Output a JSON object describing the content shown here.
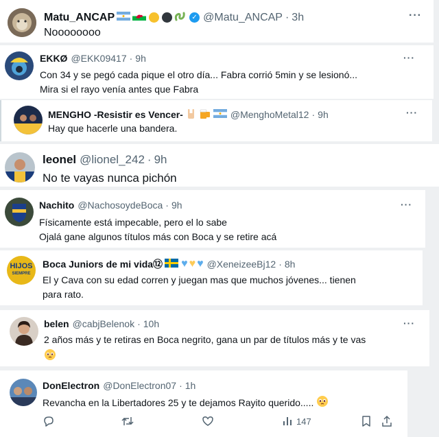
{
  "tweets": [
    {
      "name": "Matu_ANCAP",
      "handle": "@Matu_ANCAP",
      "time": "3h",
      "text": [
        "Noooooooo"
      ]
    },
    {
      "name": "EKKØ",
      "handle": "@EKK09417",
      "time": "9h",
      "text": [
        "Con 34 y se pegó cada pique el otro día... Fabra corrió 5min y se lesionó...",
        "Mira si el rayo venía antes que Fabra"
      ]
    },
    {
      "name": "MENGHO -Resistir es Vencer-",
      "handle": "@MenghoMetal12",
      "time": "9h",
      "text": [
        "Hay que hacerle una bandera."
      ]
    },
    {
      "name": "leonel",
      "handle": "@lionel_242",
      "time": "9h",
      "text": [
        "No te vayas nunca pichón"
      ]
    },
    {
      "name": "Nachito",
      "handle": "@NachosoydeBoca",
      "time": "9h",
      "text": [
        "Físicamente está impecable, pero el lo sabe",
        "Ojalá gane algunos títulos más con Boca y se retire acá"
      ]
    },
    {
      "name": "Boca Juniors de mi vida⑫",
      "handle": "@XeneizeeBj12",
      "time": "8h",
      "text": [
        "El y Cava con su edad corren y juegan mas que muchos jóvenes... tienen",
        "para rato."
      ]
    },
    {
      "name": "belen",
      "handle": "@cabjBelenok",
      "time": "10h",
      "text": [
        "2 años más y te retiras en Boca negrito, gana un par de títulos más y te vas"
      ]
    },
    {
      "name": "DonElectron",
      "handle": "@DonElectron07",
      "time": "1h",
      "text": [
        "Revancha en la Libertadores 25 y te dejamos Rayito querido..... "
      ]
    }
  ],
  "separator": "·",
  "more_label": "···",
  "avatar_initials": {
    "boca_juniors": "HIJOS",
    "boca_juniors_sub": "SIEMPRE"
  },
  "actions": {
    "views": "147"
  },
  "icons": [
    "flag-argentina-icon",
    "flag-wales-icon",
    "yellow-circle-icon",
    "black-circle-icon",
    "green-snake-icon",
    "verified-badge-icon",
    "rock-hand-icon",
    "beer-icon",
    "flag-sweden-icon",
    "blue-heart-icon",
    "yellow-heart-icon",
    "pleading-face-emoji",
    "reply-icon",
    "retweet-icon",
    "like-icon",
    "views-icon",
    "bookmark-icon",
    "share-icon"
  ],
  "colors": {
    "accent": "#1d9bf0",
    "text": "#0f1419",
    "secondary": "#536471",
    "background": "#eef0f2"
  }
}
